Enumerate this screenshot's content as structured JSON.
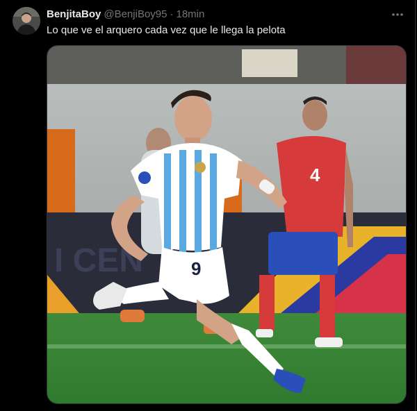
{
  "post": {
    "author": {
      "display_name": "BenjitaBoy",
      "handle": "@BenjiBoy95",
      "separator": "·",
      "time": "18min",
      "avatar_icon": "user-avatar"
    },
    "more_icon": "more-horizontal-icon",
    "text": "Lo que ve el arquero cada vez que le llega la pelota",
    "media": {
      "kind": "photo",
      "description_icon": "soccer-celebration-photo",
      "jersey_number_front": "9",
      "jersey_number_back": "4"
    }
  },
  "colors": {
    "background": "#000000",
    "text_primary": "#e7e9ea",
    "text_secondary": "#71767b",
    "border": "#2f3336"
  }
}
